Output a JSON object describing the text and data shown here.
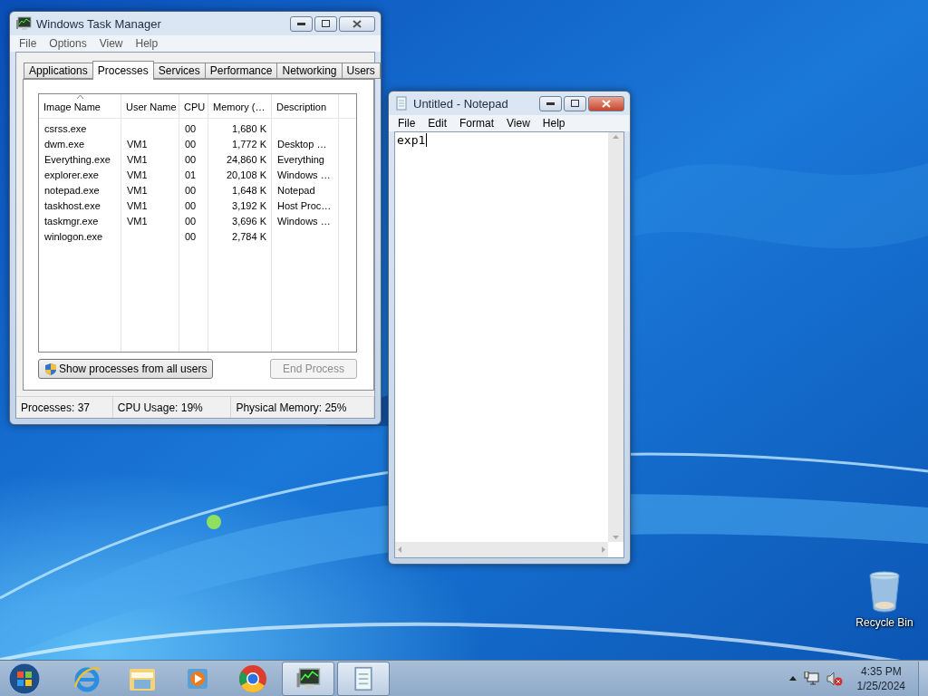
{
  "task_manager": {
    "title": "Windows Task Manager",
    "menu": [
      "File",
      "Options",
      "View",
      "Help"
    ],
    "tabs": [
      {
        "label": "Applications",
        "selected": false
      },
      {
        "label": "Processes",
        "selected": true
      },
      {
        "label": "Services",
        "selected": false
      },
      {
        "label": "Performance",
        "selected": false
      },
      {
        "label": "Networking",
        "selected": false
      },
      {
        "label": "Users",
        "selected": false
      }
    ],
    "table": {
      "columns": [
        {
          "label": "Image Name",
          "sorted": true
        },
        {
          "label": "User Name",
          "sorted": false
        },
        {
          "label": "CPU",
          "sorted": false
        },
        {
          "label": "Memory (…",
          "sorted": false
        },
        {
          "label": "Description",
          "sorted": false
        }
      ],
      "rows": [
        [
          "csrss.exe",
          "",
          "00",
          "1,680 K",
          ""
        ],
        [
          "dwm.exe",
          "VM1",
          "00",
          "1,772 K",
          "Desktop …"
        ],
        [
          "Everything.exe",
          "VM1",
          "00",
          "24,860 K",
          "Everything"
        ],
        [
          "explorer.exe",
          "VM1",
          "01",
          "20,108 K",
          "Windows …"
        ],
        [
          "notepad.exe",
          "VM1",
          "00",
          "1,648 K",
          "Notepad"
        ],
        [
          "taskhost.exe",
          "VM1",
          "00",
          "3,192 K",
          "Host Proc…"
        ],
        [
          "taskmgr.exe",
          "VM1",
          "00",
          "3,696 K",
          "Windows …"
        ],
        [
          "winlogon.exe",
          "",
          "00",
          "2,784 K",
          ""
        ]
      ]
    },
    "buttons": [
      {
        "label": "Show processes from all users",
        "kind": "shield",
        "disabled": false
      },
      {
        "label": "End Process",
        "kind": "plain",
        "disabled": true
      }
    ],
    "status_bar": [
      "Processes: 37",
      "CPU Usage: 19%",
      "Physical Memory: 25%"
    ]
  },
  "notepad": {
    "title": "Untitled - Notepad",
    "menu": [
      "File",
      "Edit",
      "Format",
      "View",
      "Help"
    ],
    "text": "exp1"
  },
  "desktop": {
    "icons": [
      {
        "kind": "recycle-bin",
        "label": "Recycle Bin"
      }
    ]
  },
  "taskbar": {
    "apps": [
      {
        "kind": "ie",
        "open": false
      },
      {
        "kind": "explorer",
        "open": false
      },
      {
        "kind": "media",
        "open": false
      },
      {
        "kind": "chrome",
        "open": false
      },
      {
        "kind": "taskmgr",
        "open": true
      },
      {
        "kind": "notepad",
        "open": true
      }
    ],
    "clock": {
      "time": "4:35 PM",
      "date": "1/25/2024"
    }
  }
}
